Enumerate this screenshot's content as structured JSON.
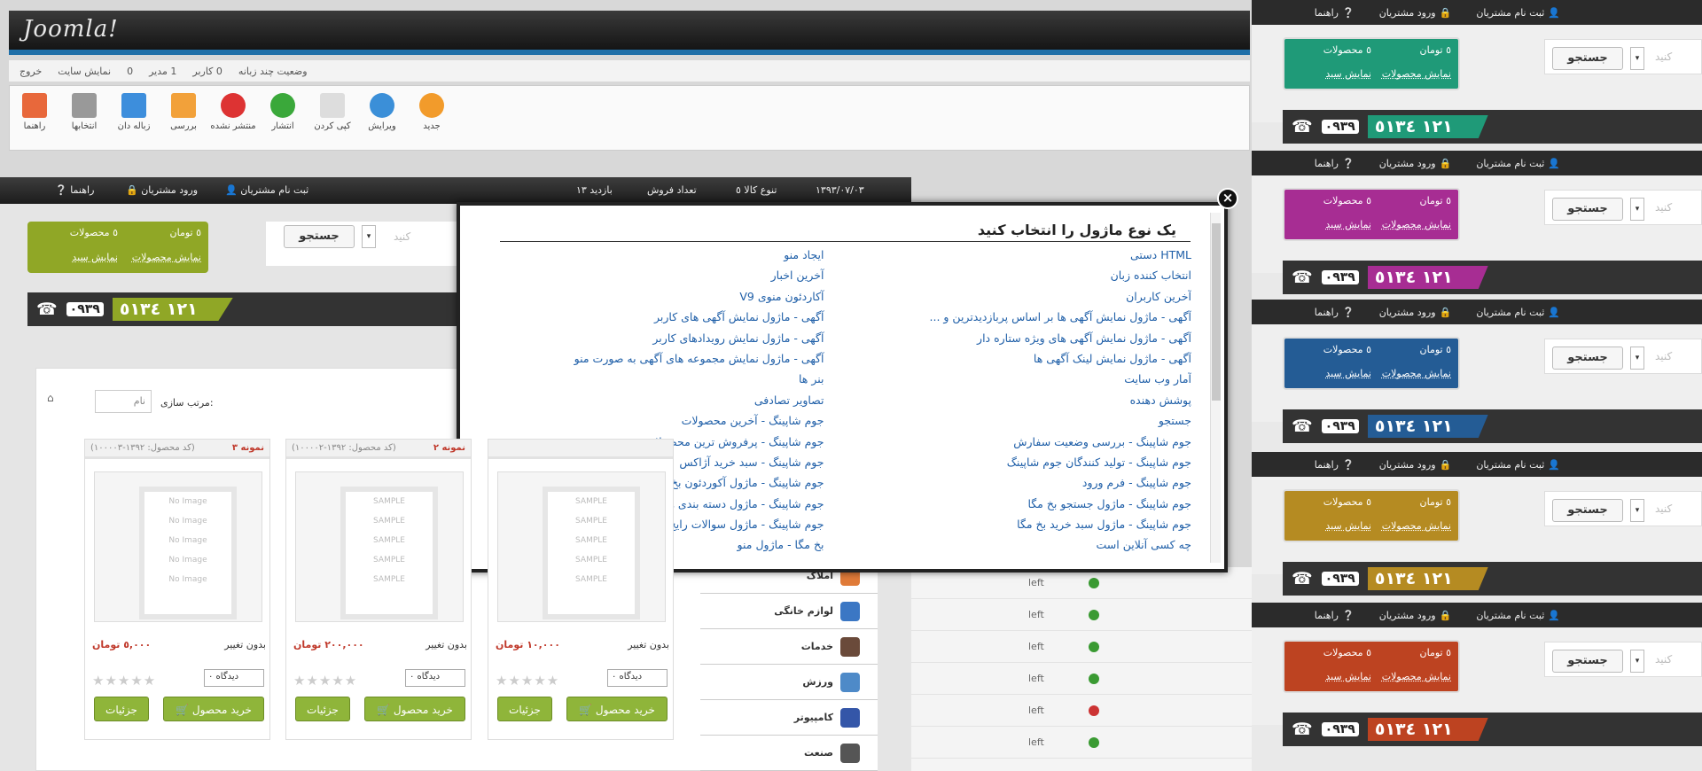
{
  "admin": {
    "logo": "Joomla!",
    "status": [
      "وضعیت چند زبانه",
      "0 کاربر",
      "1 مدیر",
      "0",
      "نمایش سایت",
      "خروج"
    ],
    "toolbar": [
      "جدید",
      "ویرایش",
      "کپی کردن",
      "انتشار",
      "منتشر نشده",
      "بررسی",
      "زباله دان",
      "انتخابها",
      "راهنما"
    ]
  },
  "previews": {
    "nav": [
      "ثبت نام مشتریان",
      "ورود مشتریان",
      "راهنما"
    ],
    "cart_toman": "٥ تومان",
    "cart_products": "٥ محصولات",
    "show_products": "نمایش محصولات",
    "show_basket": "نمایش سبد",
    "search_button": "جستجو",
    "search_placeholder": "کنید",
    "phone_prefix": "٠٩٣٩",
    "phone_number": "١٢١ ٥١٣٤",
    "colors": [
      "#1f9a78",
      "#a72d93",
      "#245c95",
      "#b58b22",
      "#bd4321"
    ]
  },
  "shop": {
    "nav": [
      "ثبت نام مشتریان",
      "ورود مشتریان",
      "راهنما"
    ],
    "stats": [
      "١٣٩٣/٠٧/٠٣",
      "تنوع کالا ٥",
      "تعداد فروش",
      "بازدید ١٣"
    ],
    "cart_toman": "٥ تومان",
    "cart_products": "٥ محصولات",
    "show_products": "نمایش محصولات",
    "show_basket": "نمایش سبد",
    "search_button": "جستجو",
    "search_placeholder": "کنید",
    "phone_prefix": "٠٩٣٩",
    "phone_number": "١٢١ ٥١٣٤",
    "sort_label": "مرتب سازی:",
    "sort_value": "نام",
    "products": [
      {
        "name": "نمونه ٣",
        "code": "(کد محصول: ١٣٩٢-١٠٠٠٠٣)",
        "status": "بدون تغییر",
        "price": "٥,٠٠٠ تومان",
        "views": "دیدگاه ٠",
        "buy": "خرید محصول",
        "details": "جزئیات",
        "image": "No Image"
      },
      {
        "name": "نمونه ٢",
        "code": "(کد محصول: ١٣٩٢-١٠٠٠٠٢)",
        "status": "بدون تغییر",
        "price": "٢٠٠,٠٠٠ تومان",
        "views": "دیدگاه ٠",
        "buy": "خرید محصول",
        "details": "جزئیات",
        "image": "SAMPLE"
      },
      {
        "name": "",
        "code": "",
        "status": "بدون تغییر",
        "price": "١٠,٠٠٠ تومان",
        "views": "دیدگاه ٠",
        "buy": "خرید محصول",
        "details": "جزئیات",
        "image": "SAMPLE"
      }
    ],
    "categories": [
      "املاک",
      "لوازم خانگی",
      "خدمات",
      "ورزش",
      "کامپیوتر",
      "صنعت"
    ]
  },
  "admin_rows": [
    "left",
    "left",
    "left",
    "left",
    "left",
    "left"
  ],
  "modal": {
    "title": "یک نوع ماژول را انتخاب کنید",
    "items": [
      "HTML دستی",
      "ایجاد منو",
      "انتخاب کننده زبان",
      "آخرین اخبار",
      "آخرین کاربران",
      "آکاردئون منوی V9",
      "آگهی - ماژول نمایش آگهی ها بر اساس پربازدیدترین و ...",
      "آگهی - ماژول نمایش آگهی های کاربر",
      "آگهی - ماژول نمایش آگهی های ویژه ستاره دار",
      "آگهی - ماژول نمایش رویدادهای کاربر",
      "آگهی - ماژول نمایش لینک آگهی ها",
      "آگهی - ماژول نمایش مجموعه های آگهی به صورت منو",
      "آمار وب سایت",
      "بنر ها",
      "پوشش دهنده",
      "تصاویر تصادفی",
      "جستجو",
      "جوم شاپینگ - آخرین محصولات",
      "جوم شاپینگ - بررسی وضعیت سفارش",
      "جوم شاپینگ - پرفروش ترین محصولات",
      "جوم شاپینگ - تولید کنندگان جوم شاپینگ",
      "جوم شاپینگ - سبد خرید آژاکس",
      "جوم شاپینگ - فرم ورود",
      "جوم شاپینگ - ماژول آکوردئون بخ مگا",
      "جوم شاپینگ - ماژول جستجو بخ مگا",
      "جوم شاپینگ - ماژول دسته بندی ها بخ مگا",
      "جوم شاپینگ - ماژول سبد خرید بخ مگا",
      "جوم شاپینگ - ماژول سوالات رایج بخ مگا",
      "چه کسی آنلاین است",
      "بخ مگا - ماژول منو"
    ]
  }
}
